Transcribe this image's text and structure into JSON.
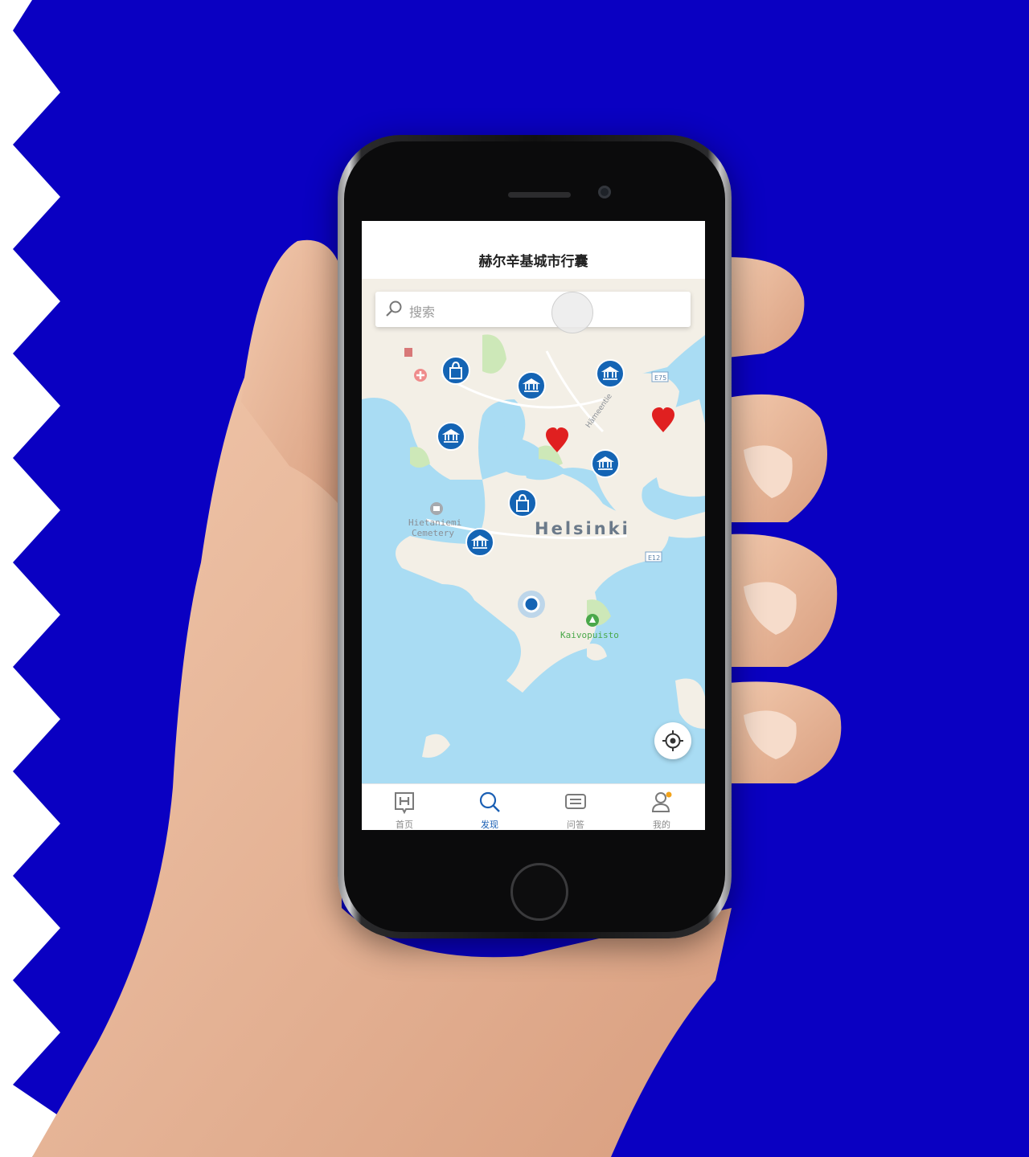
{
  "app": {
    "title": "赫尔辛基城市行囊"
  },
  "search": {
    "placeholder": "搜索"
  },
  "map": {
    "city_label": "Helsinki",
    "place_labels": [
      "Hietaniemi",
      "Cemetery",
      "Kaivopuisto"
    ],
    "street_labels": [
      "Hämeentie"
    ],
    "road_badges": [
      "E12",
      "E75",
      "E12"
    ],
    "colors": {
      "land": "#f3efe6",
      "water": "#a9dcf3",
      "park": "#cde8b8",
      "marker": "#1464b4",
      "favorite": "#e02020"
    }
  },
  "tabs": [
    {
      "label": "首页",
      "icon": "home-h-icon",
      "active": false
    },
    {
      "label": "发现",
      "icon": "search-icon",
      "active": true
    },
    {
      "label": "问答",
      "icon": "chat-icon",
      "active": false
    },
    {
      "label": "我的",
      "icon": "profile-icon",
      "active": false
    }
  ]
}
